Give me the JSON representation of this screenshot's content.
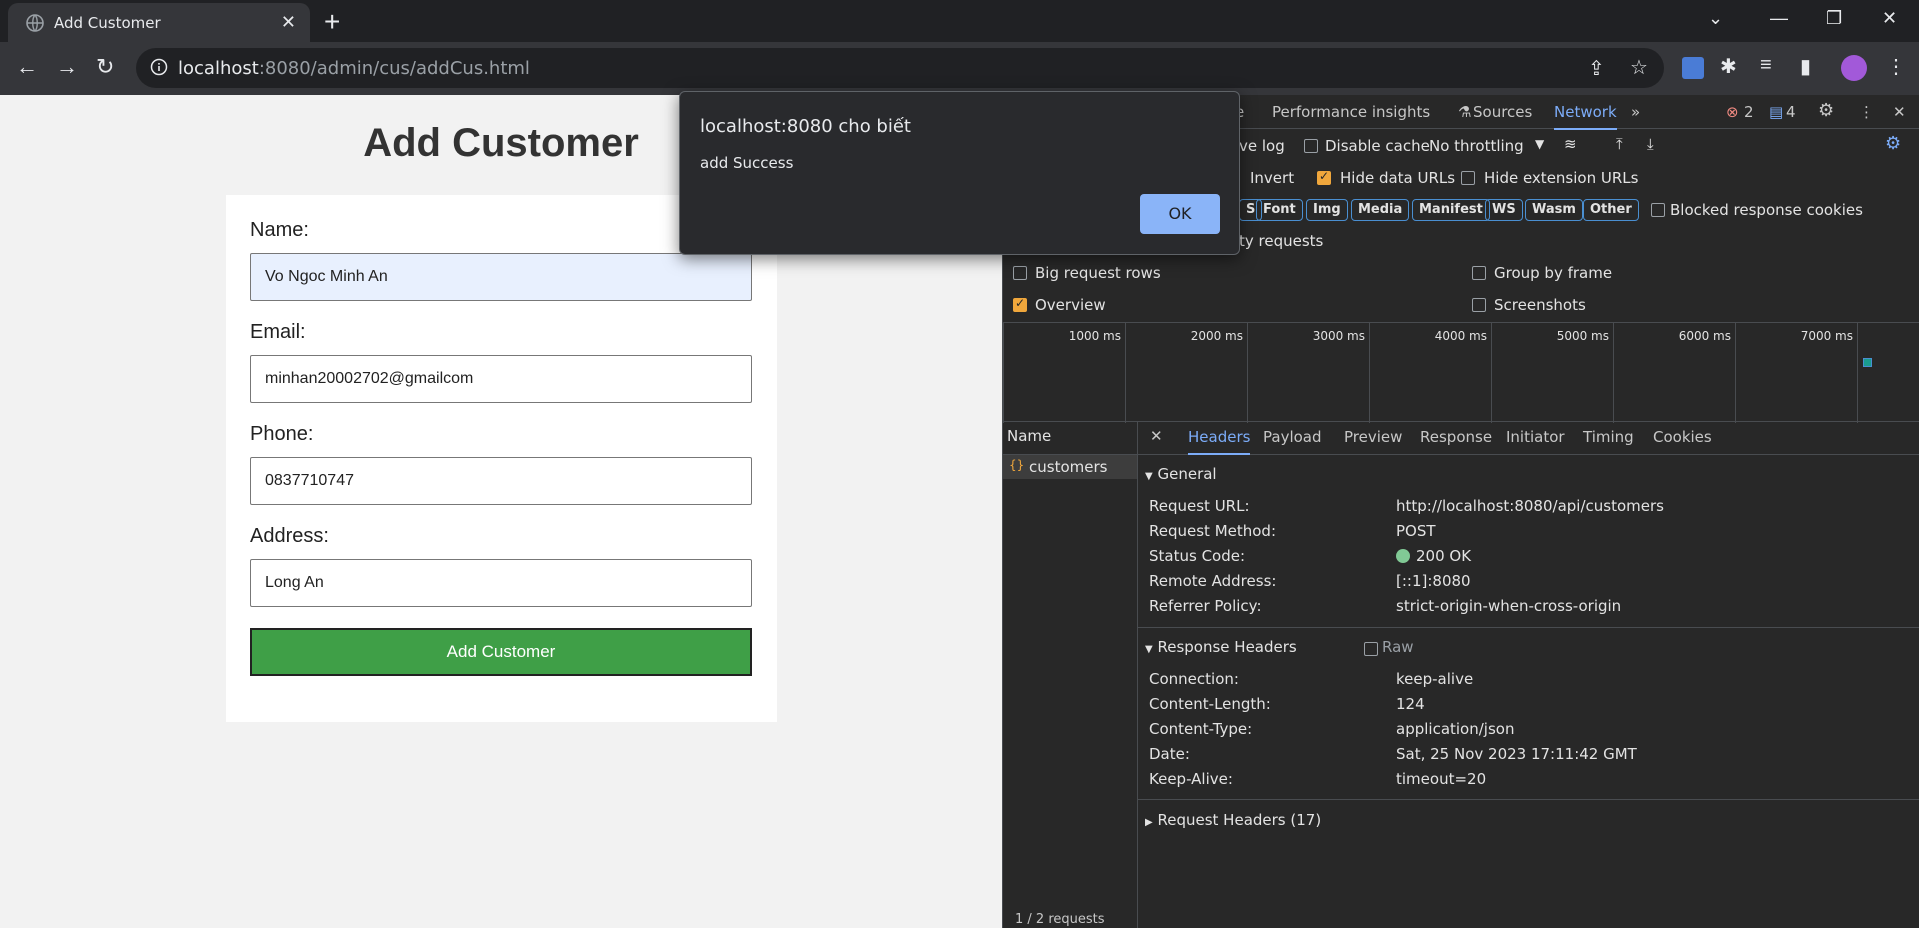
{
  "browser": {
    "tab_title": "Add Customer",
    "url_host": "localhost",
    "url_rest": ":8080/admin/cus/addCus.html"
  },
  "page": {
    "title": "Add Customer",
    "fields": [
      {
        "label": "Name:",
        "value": "Vo Ngoc Minh An"
      },
      {
        "label": "Email:",
        "value": "minhan20002702@gmailcom"
      },
      {
        "label": "Phone:",
        "value": "0837710747"
      },
      {
        "label": "Address:",
        "value": "Long An"
      }
    ],
    "submit_label": "Add Customer"
  },
  "dialog": {
    "title": "localhost:8080 cho biết",
    "message": "add Success",
    "ok_label": "OK"
  },
  "devtools": {
    "tabs": [
      "e",
      "Performance insights",
      "Sources",
      "Network"
    ],
    "errors": "2",
    "messages": "4",
    "toolbar": {
      "preserve_log": "ve log",
      "disable_cache": "Disable cache",
      "throttling": "No throttling"
    },
    "filters": {
      "invert": "Invert",
      "hide_data_urls": "Hide data URLs",
      "hide_extension_urls": "Hide extension URLs",
      "blocked_cookies": "Blocked response cookies",
      "third_party": "ty requests"
    },
    "chips": [
      "S",
      "Font",
      "Img",
      "Media",
      "Manifest",
      "WS",
      "Wasm",
      "Other"
    ],
    "options": {
      "big_rows": "Big request rows",
      "group_by_frame": "Group by frame",
      "overview": "Overview",
      "screenshots": "Screenshots"
    },
    "timeline_ticks": [
      "1000 ms",
      "2000 ms",
      "3000 ms",
      "4000 ms",
      "5000 ms",
      "6000 ms",
      "7000 ms"
    ],
    "name_header": "Name",
    "request_name": "customers",
    "footer": "1 / 2 requests",
    "detail_tabs": [
      "Headers",
      "Payload",
      "Preview",
      "Response",
      "Initiator",
      "Timing",
      "Cookies"
    ],
    "general_label": "General",
    "general": [
      {
        "k": "Request URL:",
        "v": "http://localhost:8080/api/customers"
      },
      {
        "k": "Request Method:",
        "v": "POST"
      },
      {
        "k": "Status Code:",
        "v": "200 OK"
      },
      {
        "k": "Remote Address:",
        "v": "[::1]:8080"
      },
      {
        "k": "Referrer Policy:",
        "v": "strict-origin-when-cross-origin"
      }
    ],
    "response_label": "Response Headers",
    "raw_label": "Raw",
    "response": [
      {
        "k": "Connection:",
        "v": "keep-alive"
      },
      {
        "k": "Content-Length:",
        "v": "124"
      },
      {
        "k": "Content-Type:",
        "v": "application/json"
      },
      {
        "k": "Date:",
        "v": "Sat, 25 Nov 2023 17:11:42 GMT"
      },
      {
        "k": "Keep-Alive:",
        "v": "timeout=20"
      }
    ],
    "request_headers_label": "Request Headers (17)"
  }
}
